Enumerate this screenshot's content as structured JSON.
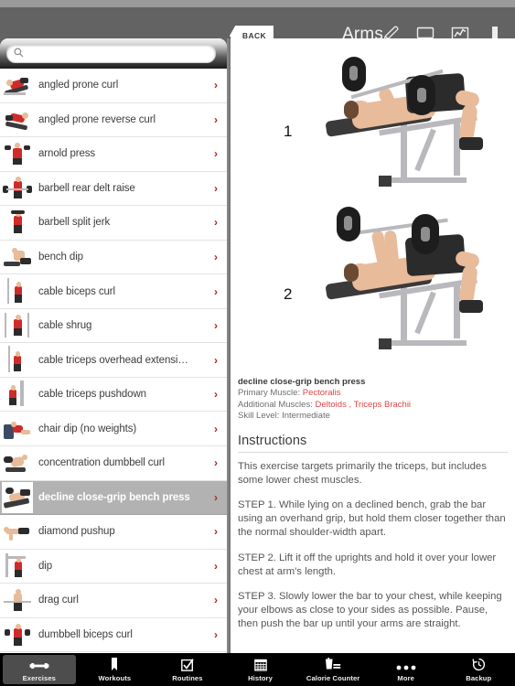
{
  "header": {
    "back_label": "BACK",
    "title": "Arms",
    "icons": [
      {
        "name": "pencil-icon",
        "label": "edit"
      },
      {
        "name": "monitor-icon",
        "label": "display"
      },
      {
        "name": "chart-icon",
        "label": "stats"
      },
      {
        "name": "bookmark-icon",
        "label": "bookmark"
      }
    ]
  },
  "search": {
    "placeholder": "",
    "value": "",
    "icon": "search-icon"
  },
  "sidebar": {
    "items": [
      {
        "label": "angled prone curl",
        "selected": false
      },
      {
        "label": "angled prone reverse curl",
        "selected": false
      },
      {
        "label": "arnold press",
        "selected": false
      },
      {
        "label": "barbell rear delt raise",
        "selected": false
      },
      {
        "label": "barbell split jerk",
        "selected": false
      },
      {
        "label": "bench dip",
        "selected": false
      },
      {
        "label": "cable biceps curl",
        "selected": false
      },
      {
        "label": "cable shrug",
        "selected": false
      },
      {
        "label": "cable triceps overhead extensi…",
        "selected": false
      },
      {
        "label": "cable triceps pushdown",
        "selected": false
      },
      {
        "label": "chair dip (no weights)",
        "selected": false
      },
      {
        "label": "concentration dumbbell curl",
        "selected": false
      },
      {
        "label": "decline close-grip bench press",
        "selected": true
      },
      {
        "label": "diamond pushup",
        "selected": false
      },
      {
        "label": "dip",
        "selected": false
      },
      {
        "label": "drag curl",
        "selected": false
      },
      {
        "label": "dumbbell biceps curl",
        "selected": false
      }
    ],
    "chevron": "›"
  },
  "detail": {
    "steps_images": [
      "1",
      "2"
    ],
    "exercise_title": "decline close-grip bench press",
    "primary_muscle_label": "Primary Muscle:",
    "primary_muscle_value": "Pectoralis",
    "additional_muscles_label": "Additional Muscles:",
    "additional_muscles_value": "Deltoids , Triceps Brachii",
    "skill_level_label": "Skill Level:",
    "skill_level_value": "Intermediate",
    "instructions_heading": "Instructions",
    "paragraphs": [
      "This exercise targets primarily the triceps, but includes some lower chest muscles.",
      "STEP 1. While lying on a declined bench, grab the bar using an overhand grip, but hold them closer together than the normal shoulder-width apart.",
      "STEP 2. Lift it off the uprights and hold it over your lower chest at arm's length.",
      "STEP 3. Slowly lower the bar to your chest, while keeping your elbows as close to your sides as possible. Pause, then push the bar up until your arms are straight."
    ]
  },
  "tabbar": {
    "items": [
      {
        "label": "Exercises",
        "icon": "dumbbell-icon",
        "active": true
      },
      {
        "label": "Workouts",
        "icon": "bookmark-icon",
        "active": false
      },
      {
        "label": "Routines",
        "icon": "checkbox-icon",
        "active": false
      },
      {
        "label": "History",
        "icon": "calendar-icon",
        "active": false
      },
      {
        "label": "Calorie Counter",
        "icon": "drink-icon",
        "active": false
      },
      {
        "label": "More",
        "icon": "ellipsis-icon",
        "active": false
      },
      {
        "label": "Backup",
        "icon": "clock-restore-icon",
        "active": false
      }
    ]
  },
  "colors": {
    "accent_red": "#b32020",
    "muscle_red": "#e04545",
    "chrome_gray": "#636363",
    "selected_row": "#b2b2b2"
  }
}
